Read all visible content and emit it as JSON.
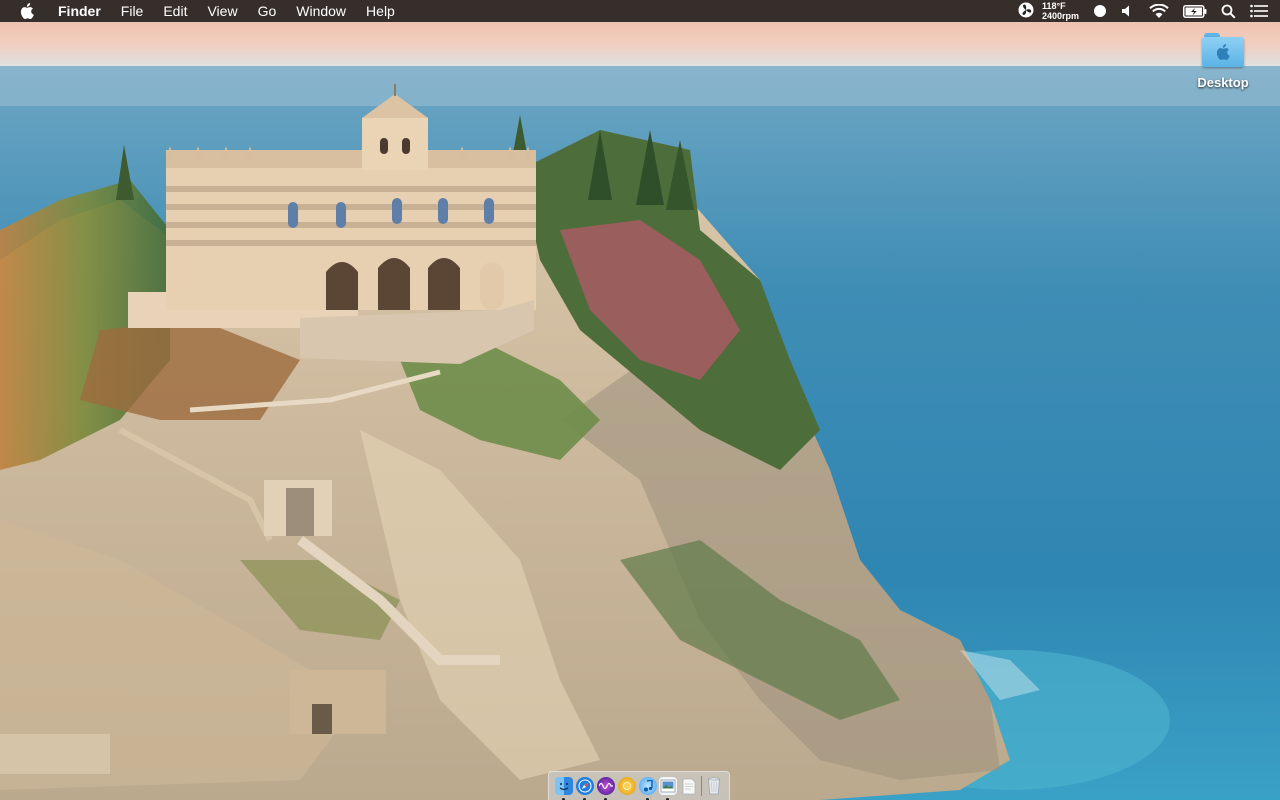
{
  "menubar": {
    "app_name": "Finder",
    "menus": [
      "File",
      "Edit",
      "View",
      "Go",
      "Window",
      "Help"
    ],
    "status": {
      "temperature": "118°F",
      "fan_speed": "2400rpm",
      "icons": [
        "fan-icon",
        "record-dot-icon",
        "volume-icon",
        "wifi-icon",
        "battery-charging-icon",
        "spotlight-search-icon",
        "notification-center-icon"
      ]
    }
  },
  "desktop": {
    "icons": [
      {
        "label": "Desktop",
        "icon": "folder-icon"
      }
    ]
  },
  "dock": {
    "items": [
      {
        "name": "finder",
        "icon": "finder-icon",
        "running": true,
        "color": "#2f86e0"
      },
      {
        "name": "safari",
        "icon": "safari-icon",
        "running": true,
        "color": "#1e7fe0"
      },
      {
        "name": "siri",
        "icon": "siri-icon",
        "running": true,
        "color": "#6a3cc8"
      },
      {
        "name": "app-gold",
        "icon": "gold-circle-icon",
        "running": false,
        "color": "#f2b822"
      },
      {
        "name": "music",
        "icon": "music-note-icon",
        "running": true,
        "color": "#3aa0f2"
      },
      {
        "name": "preview",
        "icon": "preview-icon",
        "running": true,
        "color": "#5a8fc8"
      },
      {
        "name": "textedit",
        "icon": "document-icon",
        "running": false,
        "color": "#f4f4f4"
      }
    ],
    "trash": {
      "icon": "trash-icon"
    }
  },
  "colors": {
    "menubar_bg": "#262220",
    "sea": "#3f8fb0",
    "folder": "#5ab3e6"
  }
}
